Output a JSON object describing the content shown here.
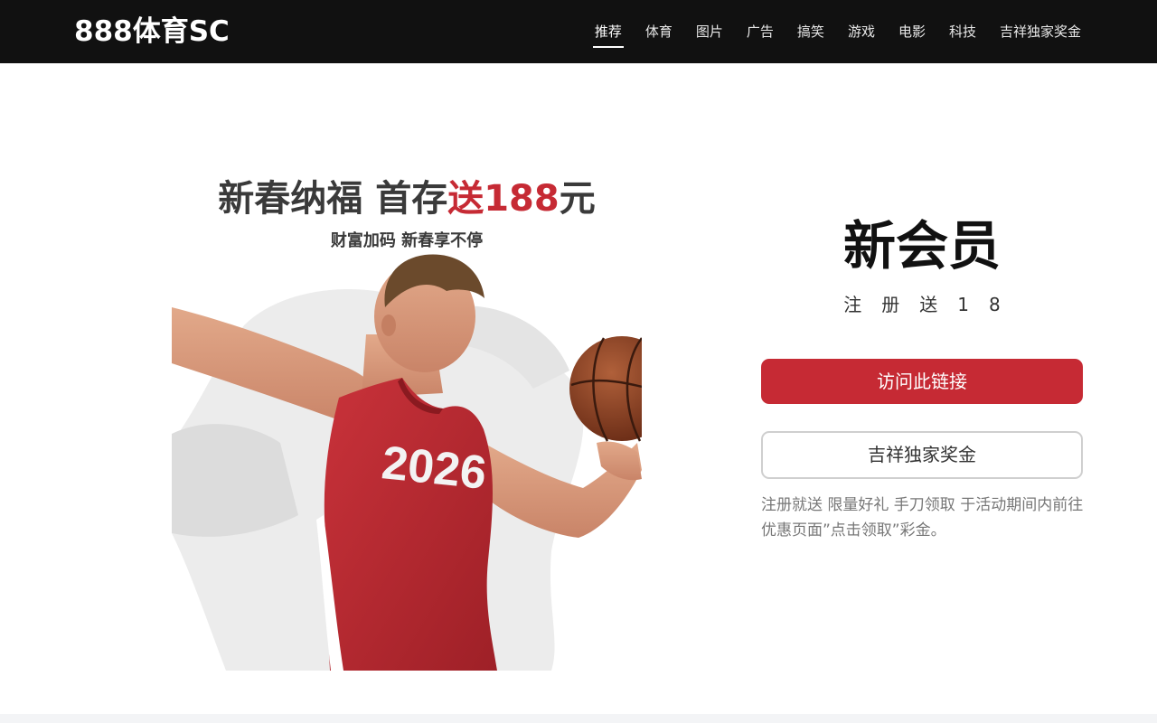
{
  "header": {
    "logo": "888体育SC",
    "nav": [
      {
        "label": "推荐",
        "active": true
      },
      {
        "label": "体育",
        "active": false
      },
      {
        "label": "图片",
        "active": false
      },
      {
        "label": "广告",
        "active": false
      },
      {
        "label": "搞笑",
        "active": false
      },
      {
        "label": "游戏",
        "active": false
      },
      {
        "label": "电影",
        "active": false
      },
      {
        "label": "科技",
        "active": false
      },
      {
        "label": "吉祥独家奖金",
        "active": false
      }
    ]
  },
  "promo": {
    "headline_part1": "新春纳福 首存",
    "headline_highlight": "送188",
    "headline_part2": "元",
    "subline": "财富加码 新春享不停",
    "jersey_number": "2026"
  },
  "side": {
    "title": "新会员",
    "subtitle": "注册送18",
    "primary_button": "访问此链接",
    "secondary_button": "吉祥独家奖金",
    "note": "注册就送 限量好礼 手刀领取 于活动期间内前往优惠页面”点击领取”彩金。"
  },
  "colors": {
    "accent": "#c62a34",
    "topbar": "#111111",
    "jersey": "#b3262e"
  }
}
